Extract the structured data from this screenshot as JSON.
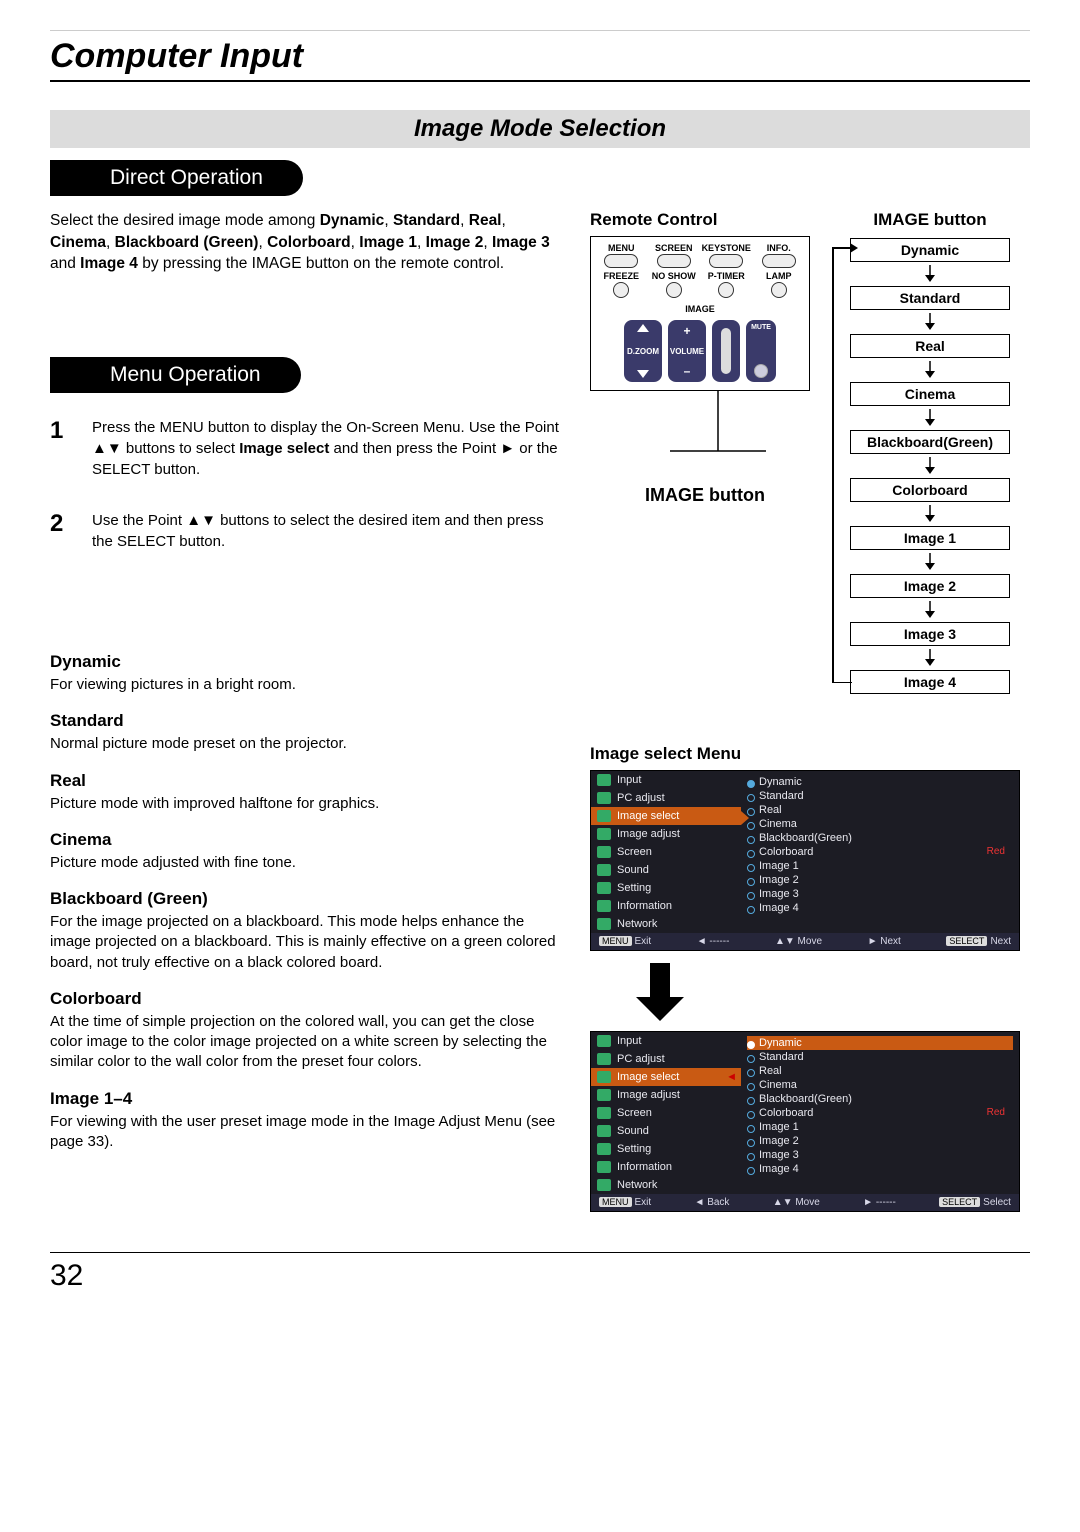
{
  "page": {
    "title": "Computer Input",
    "section_heading": "Image Mode Selection",
    "number": "32"
  },
  "direct_operation": {
    "tab": "Direct Operation",
    "paragraph_parts": [
      "Select the desired image mode among ",
      "Dynamic",
      ", ",
      "Standard",
      ", ",
      "Real",
      ", ",
      "Cinema",
      ", ",
      "Blackboard (Green)",
      ", ",
      "Colorboard",
      ", ",
      "Image 1",
      ", ",
      "Image 2",
      ", ",
      "Image 3",
      " and ",
      "Image 4",
      " by pressing the IMAGE button on the remote control."
    ]
  },
  "menu_operation": {
    "tab": "Menu Operation",
    "steps": [
      {
        "num": "1",
        "text": "Press the MENU button to display the On-Screen Menu. Use the Point ▲▼ buttons to select Image select and then press the Point ► or the SELECT button."
      },
      {
        "num": "2",
        "text": "Use the Point ▲▼ buttons to select  the desired item and then press the SELECT button."
      }
    ]
  },
  "modes": [
    {
      "title": "Dynamic",
      "desc": "For viewing pictures in a bright room."
    },
    {
      "title": "Standard",
      "desc": "Normal picture mode preset on the projector."
    },
    {
      "title": "Real",
      "desc": "Picture mode with improved halftone for graphics."
    },
    {
      "title": "Cinema",
      "desc": "Picture mode adjusted with fine tone."
    },
    {
      "title": "Blackboard (Green)",
      "desc": "For the image projected on a blackboard.\nThis mode helps enhance the image projected on a blackboard. This is mainly effective on a green colored board, not truly effective on a black colored board."
    },
    {
      "title": "Colorboard",
      "desc": "At the time of simple projection on the colored wall, you can get the close color image to the color image projected on a white screen by selecting the similar color to the wall color from the preset four colors."
    },
    {
      "title": "Image 1–4",
      "desc": "For viewing with the user preset image mode in the Image Adjust Menu (see page 33)."
    }
  ],
  "remote": {
    "title": "Remote Control",
    "caption": "IMAGE button",
    "row1": [
      "MENU",
      "SCREEN",
      "KEYSTONE",
      "INFO."
    ],
    "row2": [
      "FREEZE",
      "NO SHOW",
      "P-TIMER",
      "LAMP"
    ],
    "image_label": "IMAGE",
    "dzoom": "D.ZOOM",
    "volume": "VOLUME",
    "mute": "MUTE"
  },
  "image_chain": {
    "title": "IMAGE button",
    "items": [
      "Dynamic",
      "Standard",
      "Real",
      "Cinema",
      "Blackboard(Green)",
      "Colorboard",
      "Image 1",
      "Image 2",
      "Image 3",
      "Image 4"
    ]
  },
  "menu_screenshot": {
    "title": "Image select Menu",
    "left_items": [
      "Input",
      "PC adjust",
      "Image select",
      "Image adjust",
      "Screen",
      "Sound",
      "Setting",
      "Information",
      "Network"
    ],
    "right_items": [
      "Dynamic",
      "Standard",
      "Real",
      "Cinema",
      "Blackboard(Green)",
      "Colorboard",
      "Image 1",
      "Image 2",
      "Image 3",
      "Image 4"
    ],
    "red_label": "Red",
    "foot1": {
      "exit": "Exit",
      "menu": "MENU",
      "move": "Move",
      "next": "Next",
      "select": "Next",
      "selectTag": "SELECT"
    },
    "foot2": {
      "exit": "Exit",
      "menu": "MENU",
      "back": "Back",
      "move": "Move",
      "dash": "------",
      "select": "Select",
      "selectTag": "SELECT"
    }
  }
}
